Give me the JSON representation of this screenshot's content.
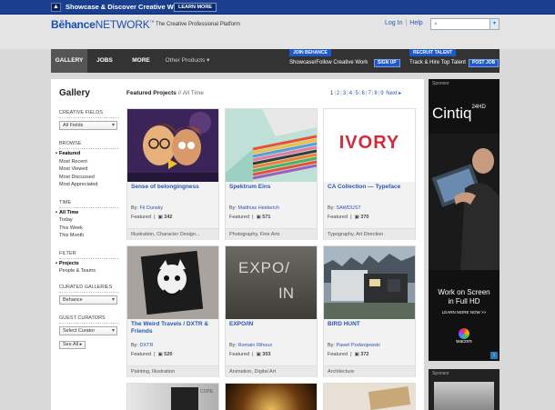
{
  "promo": {
    "text": "Showcase & Discover Creative Work",
    "button": "LEARN MORE"
  },
  "header": {
    "logo_behance": "Bēhance",
    "logo_network": "NETWORK",
    "logo_tm": "™",
    "tagline": "The Creative Professional Platform",
    "login": "Log In",
    "help": "Help",
    "search_placeholder": ""
  },
  "nav": {
    "tabs": [
      {
        "label": "GALLERY"
      },
      {
        "label": "JOBS"
      },
      {
        "label": "MORE"
      },
      {
        "label": "Other Products"
      }
    ],
    "join_label": "JOIN BEHANCE",
    "join_text": "Showcase/Follow Creative Work",
    "signup": "SIGN UP",
    "recruit_label": "RECRUIT TALENT",
    "recruit_text": "Track & Hire Top Talent",
    "post_job": "POST JOB"
  },
  "sidebar": {
    "title": "Gallery",
    "creative_fields_heading": "CREATIVE FIELDS",
    "creative_fields_value": "All Fields",
    "browse_heading": "BROWSE",
    "browse_items": [
      "Featured",
      "Most Recent",
      "Most Viewed",
      "Most Discussed",
      "Most Appreciated"
    ],
    "time_heading": "TIME",
    "time_items": [
      "All Time",
      "Today",
      "This Week",
      "This Month"
    ],
    "filter_heading": "FILTER",
    "filter_items": [
      "Projects",
      "People & Teams"
    ],
    "curated_heading": "CURATED GALLERIES",
    "curated_value": "Behance",
    "guest_heading": "GUEST CURATORS",
    "guest_value": "Select Curator",
    "see_all": "See All ▸"
  },
  "content": {
    "title": "Featured Projects",
    "subtitle": "// All Time",
    "pages": [
      "1",
      "2",
      "3",
      "4",
      "5",
      "6",
      "7",
      "8",
      "9"
    ],
    "next": "Next ▸",
    "projects": [
      {
        "title": "Sense of belongingness",
        "by": "Fil Dunsky",
        "featured": "Featured",
        "count": "342",
        "category": "Illustration, Character Design..."
      },
      {
        "title": "Spektrum Eins",
        "by": "Matthias Heiderich",
        "featured": "Featured",
        "count": "571",
        "category": "Photography, Fine Arts"
      },
      {
        "title": "CA Collection — Typeface",
        "by": "SAWDUST",
        "featured": "Featured",
        "count": "370",
        "category": "Typography, Art Direction"
      },
      {
        "title": "The Weird Travels / DXTR & Friends",
        "by": "DXTR",
        "featured": "Featured",
        "count": "520",
        "category": "Painting, Illustration"
      },
      {
        "title": "EXPO/IN",
        "by": "Romain Rihoux",
        "featured": "Featured",
        "count": "303",
        "category": "Animation, Digital Art"
      },
      {
        "title": "BIRD HUNT",
        "by": "Pawel Podwojewski",
        "featured": "Featured",
        "count": "372",
        "category": "Architecture"
      }
    ],
    "by_label": "By:",
    "thumb_texts": {
      "ivory": "IVORY",
      "expo": "EXPO/",
      "in": "IN",
      "copy": "COPE"
    }
  },
  "ad": {
    "sponsor": "Sponsor",
    "brand": "Cintiq",
    "brand_sub": "24HD",
    "headline1": "Work on Screen",
    "headline2": "in Full HD",
    "learn_more": "LEARN MORE NOW >>",
    "wacom": "wacom"
  }
}
